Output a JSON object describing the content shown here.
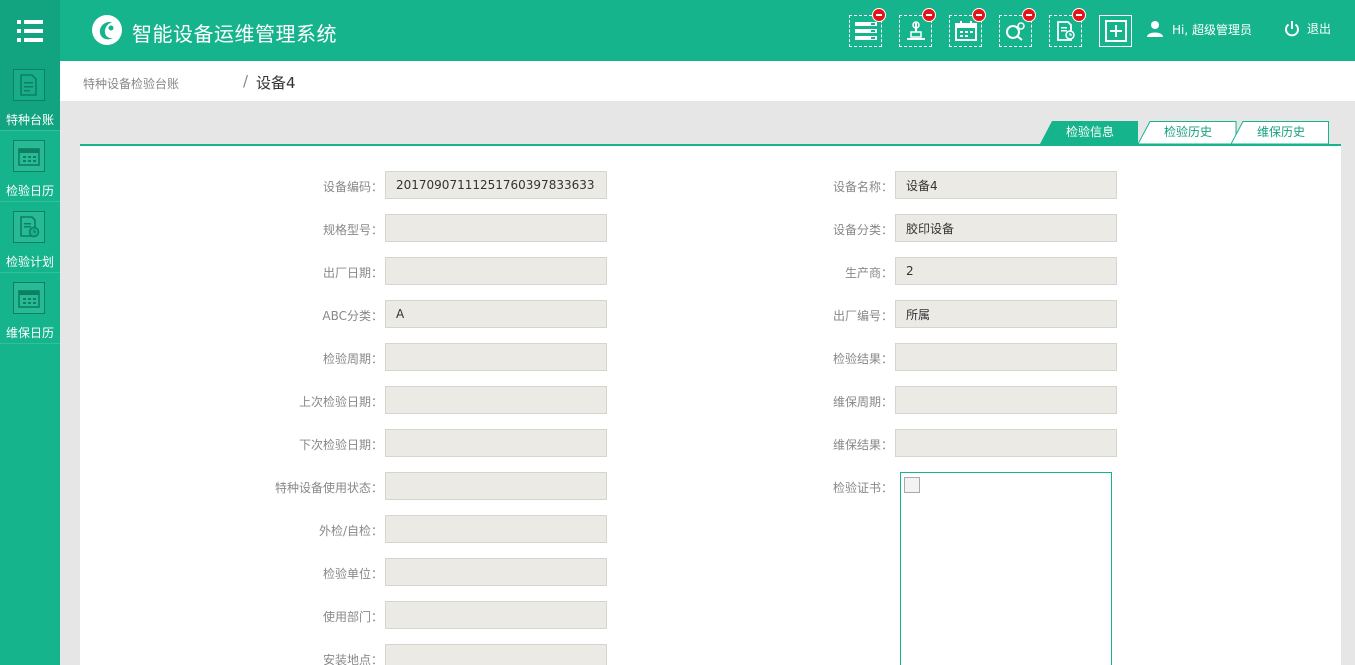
{
  "header": {
    "app_title": "智能设备运维管理系统",
    "user_greeting": "Hi, 超级管理员",
    "logout_label": "退出",
    "tools": [
      {
        "icon": "list-icon"
      },
      {
        "icon": "equipment-icon"
      },
      {
        "icon": "calendar-icon"
      },
      {
        "icon": "search-gear-icon"
      },
      {
        "icon": "document-clock-icon"
      },
      {
        "icon": "add-icon"
      }
    ]
  },
  "sidebar": {
    "items": [
      {
        "label": "特种台账",
        "icon": "ledger-icon",
        "active": true
      },
      {
        "label": "检验日历",
        "icon": "calendar-icon"
      },
      {
        "label": "检验计划",
        "icon": "plan-icon"
      },
      {
        "label": "维保日历",
        "icon": "calendar-icon"
      }
    ]
  },
  "breadcrumb": {
    "parent": "特种设备检验台账",
    "separator": "/",
    "current": "设备4"
  },
  "tabs": [
    {
      "label": "检验信息",
      "active": true
    },
    {
      "label": "检验历史"
    },
    {
      "label": "维保历史"
    }
  ],
  "form": {
    "left": [
      {
        "label": "设备编码：",
        "value": "20170907111251760397833633"
      },
      {
        "label": "规格型号：",
        "value": ""
      },
      {
        "label": "出厂日期：",
        "value": ""
      },
      {
        "label": "ABC分类：",
        "value": "A"
      },
      {
        "label": "检验周期：",
        "value": ""
      },
      {
        "label": "上次检验日期：",
        "value": ""
      },
      {
        "label": "下次检验日期：",
        "value": ""
      },
      {
        "label": "特种设备使用状态：",
        "value": ""
      },
      {
        "label": "外检/自检：",
        "value": ""
      },
      {
        "label": "检验单位：",
        "value": ""
      },
      {
        "label": "使用部门：",
        "value": ""
      },
      {
        "label": "安装地点：",
        "value": ""
      }
    ],
    "right": [
      {
        "label": "设备名称：",
        "value": "设备4"
      },
      {
        "label": "设备分类：",
        "value": "胶印设备"
      },
      {
        "label": "生产商：",
        "value": "2"
      },
      {
        "label": "出厂编号：",
        "value": "所属"
      },
      {
        "label": "检验结果：",
        "value": ""
      },
      {
        "label": "维保周期：",
        "value": ""
      },
      {
        "label": "维保结果：",
        "value": ""
      }
    ],
    "certificate_label": "检验证书："
  },
  "colors": {
    "brand": "#16b48c",
    "brand_dark": "#12a380",
    "badge": "#e4141b",
    "input_bg": "#ebeae5"
  }
}
